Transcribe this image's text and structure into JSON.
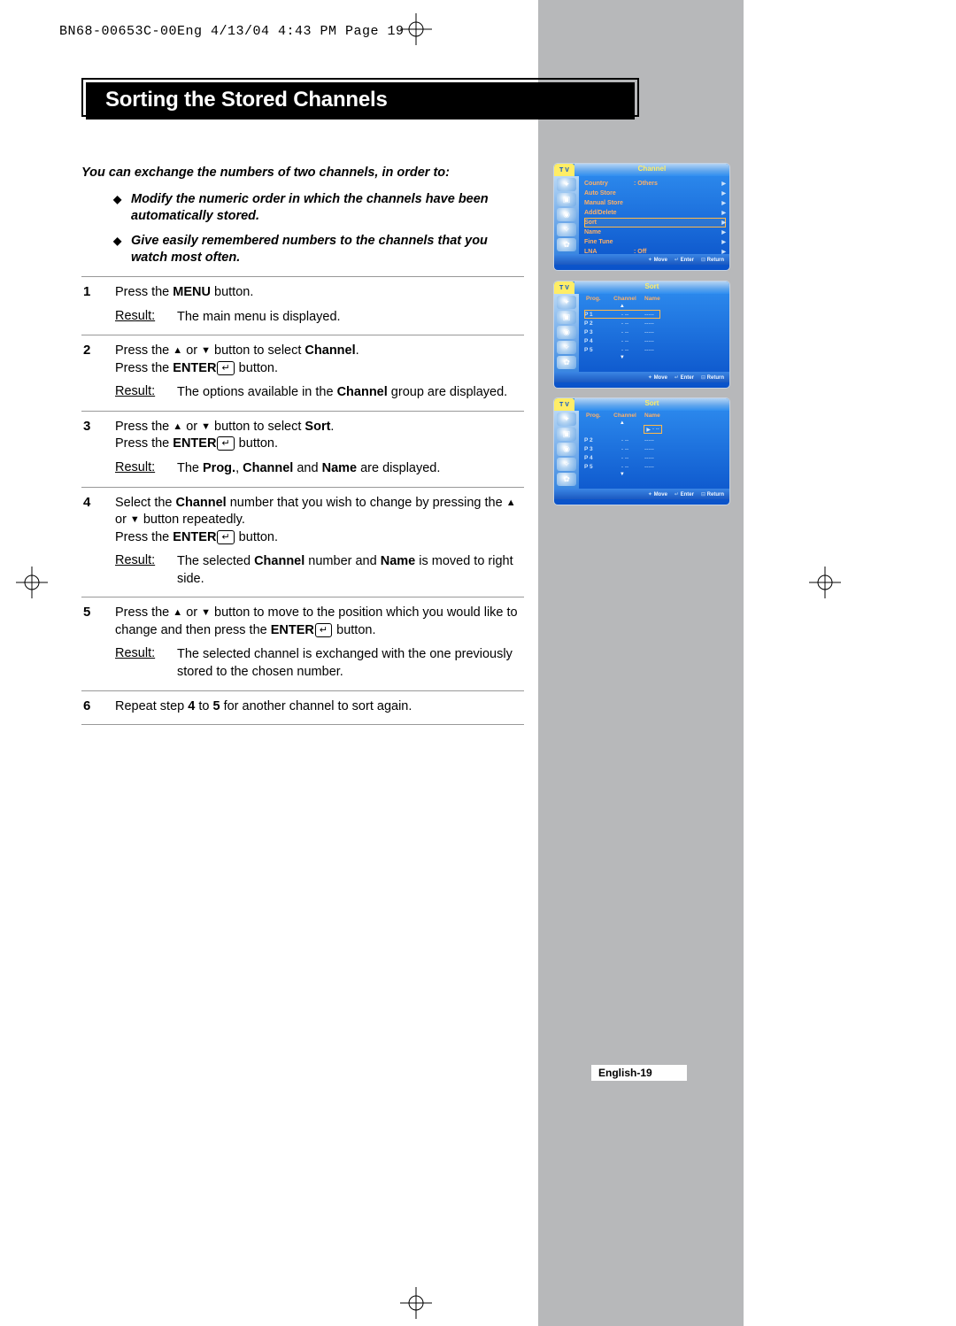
{
  "crop_header": "BN68-00653C-00Eng  4/13/04 4:43 PM  Page 19",
  "title": "Sorting the Stored Channels",
  "intro_lead": "You can exchange the numbers of two channels, in order to:",
  "intro_bullets": [
    "Modify the numeric order in which the channels have been automatically stored.",
    "Give easily remembered numbers to the channels that you watch most often."
  ],
  "steps": [
    {
      "num": "1",
      "body_html": "Press the <b>MENU</b> button.",
      "result": "The main menu is displayed."
    },
    {
      "num": "2",
      "body_html": "Press the <span class='triangle'>▲</span> or <span class='triangle'>▼</span> button to select <b>Channel</b>.<br>Press the <b>ENTER</b><span class='enter-icon'>↵</span> button.",
      "result_html": "The options available in the <b>Channel</b> group are displayed."
    },
    {
      "num": "3",
      "body_html": "Press the <span class='triangle'>▲</span> or <span class='triangle'>▼</span> button to select <b>Sort</b>.<br>Press the <b>ENTER</b><span class='enter-icon'>↵</span> button.",
      "result_html": "The <b>Prog.</b>, <b>Channel</b> and <b>Name</b> are displayed."
    },
    {
      "num": "4",
      "body_html": "Select the <b>Channel</b> number that you wish to change by pressing the <span class='triangle'>▲</span> or <span class='triangle'>▼</span> button repeatedly.<br>Press the <b>ENTER</b><span class='enter-icon'>↵</span> button.",
      "result_html": "The selected <b>Channel</b> number and <b>Name</b> is moved to right side."
    },
    {
      "num": "5",
      "body_html": "Press the <span class='triangle'>▲</span> or <span class='triangle'>▼</span> button to move to the position which you would like to change and then press the <b>ENTER</b><span class='enter-icon'>↵</span> button.",
      "result": "The selected channel is exchanged with the one previously stored to the chosen number."
    },
    {
      "num": "6",
      "body_html": "Repeat step <b>4</b> to <b>5</b> for another channel to sort again."
    }
  ],
  "result_label": "Result:",
  "osd": {
    "tv_label": "T V",
    "footer": {
      "move": "Move",
      "enter": "Enter",
      "return": "Return"
    },
    "screen1": {
      "title": "Channel",
      "rows": [
        {
          "label": "Country",
          "value": ": Others",
          "hl": false
        },
        {
          "label": "Auto Store",
          "value": "",
          "hl": false
        },
        {
          "label": "Manual Store",
          "value": "",
          "hl": false
        },
        {
          "label": "Add/Delete",
          "value": "",
          "hl": false
        },
        {
          "label": "Sort",
          "value": "",
          "hl": true
        },
        {
          "label": "Name",
          "value": "",
          "hl": false
        },
        {
          "label": "Fine Tune",
          "value": "",
          "hl": false
        },
        {
          "label": "LNA",
          "value": ": Off",
          "hl": false
        }
      ]
    },
    "screen2": {
      "title": "Sort",
      "headers": {
        "prog": "Prog.",
        "channel": "Channel",
        "name": "Name"
      },
      "rows": [
        {
          "prog": "P  1",
          "ch": "-  --",
          "name": "-----",
          "hl": true
        },
        {
          "prog": "P  2",
          "ch": "-  --",
          "name": "-----",
          "hl": false
        },
        {
          "prog": "P  3",
          "ch": "-  --",
          "name": "-----",
          "hl": false
        },
        {
          "prog": "P  4",
          "ch": "-  --",
          "name": "-----",
          "hl": false
        },
        {
          "prog": "P  5",
          "ch": "-  --",
          "name": "-----",
          "hl": false
        }
      ]
    },
    "screen3": {
      "title": "Sort",
      "headers": {
        "prog": "Prog.",
        "channel": "Channel",
        "name": "Name"
      },
      "right_box": "-  --",
      "rows": [
        {
          "prog": "",
          "ch": "",
          "name": "",
          "hl": false
        },
        {
          "prog": "P  2",
          "ch": "-  --",
          "name": "-----",
          "hl": false
        },
        {
          "prog": "P  3",
          "ch": "-  --",
          "name": "-----",
          "hl": false
        },
        {
          "prog": "P  4",
          "ch": "-  --",
          "name": "-----",
          "hl": false
        },
        {
          "prog": "P  5",
          "ch": "-  --",
          "name": "-----",
          "hl": false
        }
      ]
    }
  },
  "page_foot": "English-19"
}
